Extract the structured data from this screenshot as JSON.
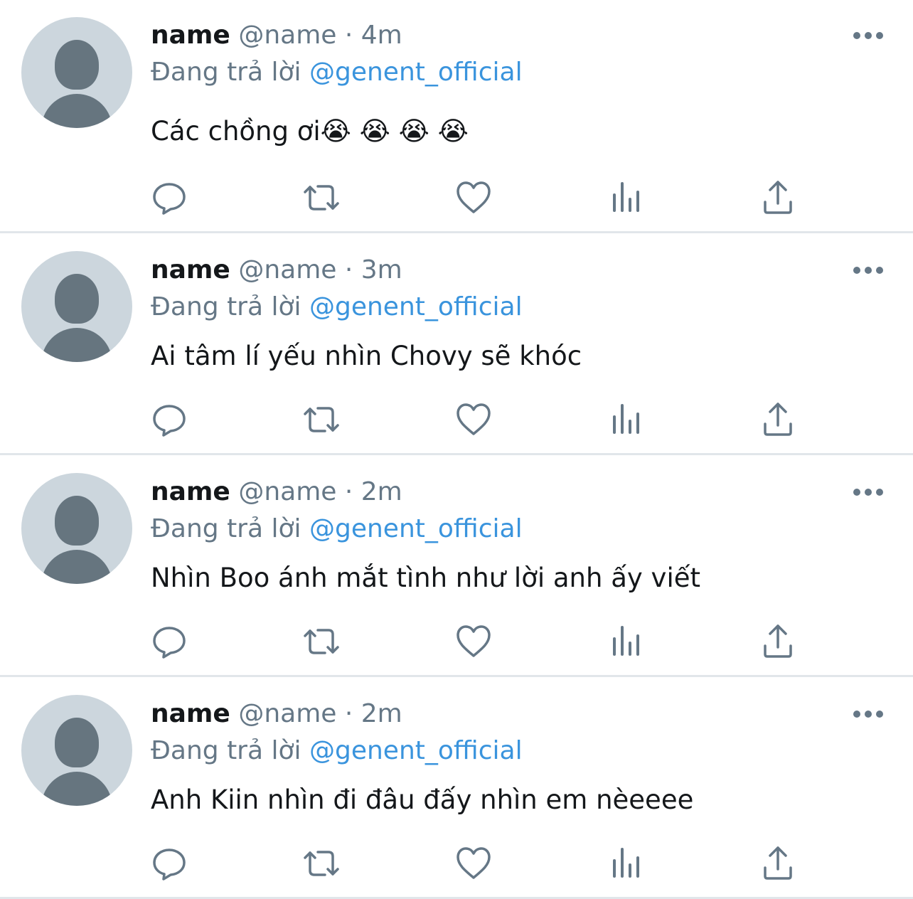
{
  "tweets": [
    {
      "display_name": "name",
      "handle": "@name",
      "separator": "·",
      "time": "4m",
      "replying_label": "Đang trả lời",
      "mention": "@genent_official",
      "text": "Các chồng ơi😭 😭 😭 😭"
    },
    {
      "display_name": "name",
      "handle": "@name",
      "separator": "·",
      "time": "3m",
      "replying_label": "Đang trả lời",
      "mention": "@genent_official",
      "text": "Ai tâm lí yếu nhìn Chovy sẽ khóc"
    },
    {
      "display_name": "name",
      "handle": "@name",
      "separator": "·",
      "time": "2m",
      "replying_label": "Đang trả lời",
      "mention": "@genent_official",
      "text": "Nhìn Boo ánh mắt tình như lời anh ấy viết"
    },
    {
      "display_name": "name",
      "handle": "@name",
      "separator": "·",
      "time": "2m",
      "replying_label": "Đang trả lời",
      "mention": "@genent_official",
      "text": "Anh Kiin nhìn đi đâu đấy nhìn em nèeeee"
    }
  ],
  "icons": {
    "reply": "reply-icon",
    "retweet": "retweet-icon",
    "like": "like-icon",
    "analytics": "analytics-icon",
    "share": "share-icon",
    "more": "more-icon"
  },
  "colors": {
    "mention": "#3a94dd",
    "secondary_text": "#657786",
    "avatar_bg": "#ccd6dd",
    "avatar_fg": "#66757f"
  }
}
